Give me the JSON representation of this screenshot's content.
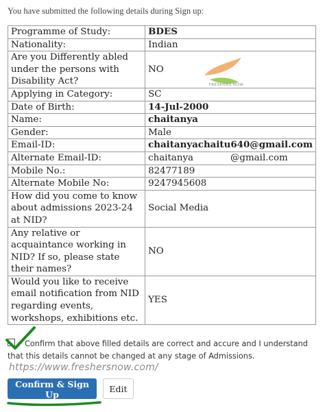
{
  "intro_text": "You have submitted the following details during Sign up:",
  "details": [
    {
      "label": "Programme of Study:",
      "value": "BDES",
      "bold": true
    },
    {
      "label": "Nationality:",
      "value": "Indian",
      "bold": false
    },
    {
      "label": "Are you Differently abled under the persons with Disability Act?",
      "value": "NO",
      "bold": false
    },
    {
      "label": "Applying in Category:",
      "value": "SC",
      "bold": false
    },
    {
      "label": "Date of Birth:",
      "value": "14-Jul-2000",
      "bold": true
    },
    {
      "label": "Name:",
      "value": "chaitanya",
      "bold": true
    },
    {
      "label": "Gender:",
      "value": "Male",
      "bold": false
    },
    {
      "label": "Email-ID:",
      "value": "chaitanyachaitu640@gmail.com",
      "bold": true
    },
    {
      "label": "Alternate Email-ID:",
      "value_part1": "chaitanya",
      "value_part2": "@gmail.com",
      "bold": false
    },
    {
      "label": "Mobile No.:",
      "value": "82477189",
      "bold": false
    },
    {
      "label": "Alternate Mobile No:",
      "value": "9247945608",
      "bold": false
    },
    {
      "label": "How did you come to know about admissions 2023-24 at NID?",
      "value": "Social Media",
      "bold": false
    },
    {
      "label": "Any relative or acquaintance working in NID? If so, please state their names?",
      "value": "NO",
      "bold": false
    },
    {
      "label": "Would you like to receive email notification from NID regarding events, workshops, exhibitions etc.",
      "value": "YES",
      "bold": false
    }
  ],
  "watermark": {
    "text": "FRESHERS NOW",
    "colors": {
      "leaf_orange": "#f5a15a",
      "leaf_green": "#8cc63f"
    }
  },
  "confirm": {
    "checkbox_checked": true,
    "text": "Confirm that above filled details are correct and accure and I understand that this details cannot be changed at any stage of Admissions."
  },
  "site_url": "https://www.freshersnow.com/",
  "buttons": {
    "confirm_label": "Confirm & Sign Up",
    "edit_label": "Edit"
  },
  "colors": {
    "primary_button": "#2a6fb2",
    "annotation_green": "#1e8a1e"
  }
}
